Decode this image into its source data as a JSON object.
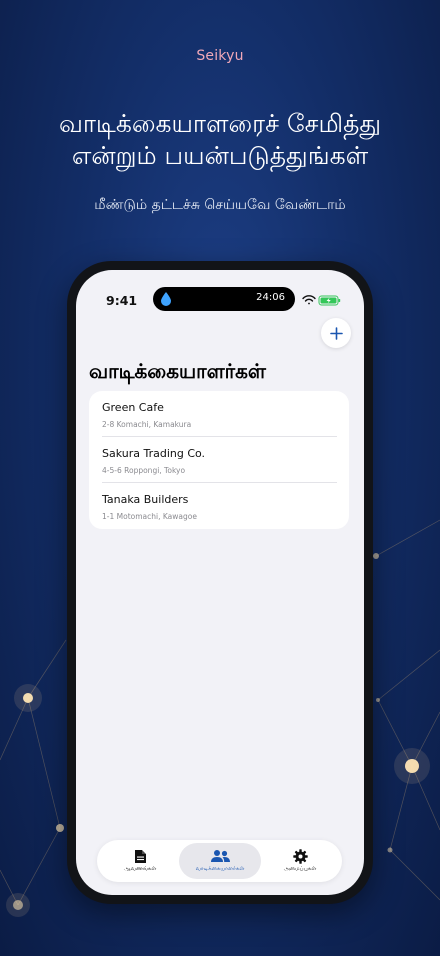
{
  "brand": "Seikyu",
  "headline": {
    "line1": "வாடிக்கையாளரைச் சேமித்து",
    "line2": "என்றும் பயன்படுத்துங்கள்"
  },
  "subheadline": "மீண்டும் தட்டச்சு செய்யவே வேண்டாம்",
  "status_bar": {
    "time": "9:41",
    "island_timer": "24:06"
  },
  "screen": {
    "title": "வாடிக்கையாளர்கள்",
    "add_icon": "plus-icon"
  },
  "customers": [
    {
      "name": "Green Cafe",
      "address": "2-8 Komachi, Kamakura"
    },
    {
      "name": "Sakura Trading Co.",
      "address": "4-5-6 Roppongi, Tokyo"
    },
    {
      "name": "Tanaka Builders",
      "address": "1-1 Motomachi, Kawagoe"
    }
  ],
  "tabs": [
    {
      "label": "ஆவணங்கள்",
      "icon": "document-icon",
      "active": false
    },
    {
      "label": "வாடிக்கையாளர்கள்",
      "icon": "people-icon",
      "active": true
    },
    {
      "label": "அமைப்புகள்",
      "icon": "gear-icon",
      "active": false
    }
  ],
  "colors": {
    "background": "#132e68",
    "brand_text": "#f0a8b8",
    "accent": "#1a56b0",
    "battery": "#34c759"
  }
}
